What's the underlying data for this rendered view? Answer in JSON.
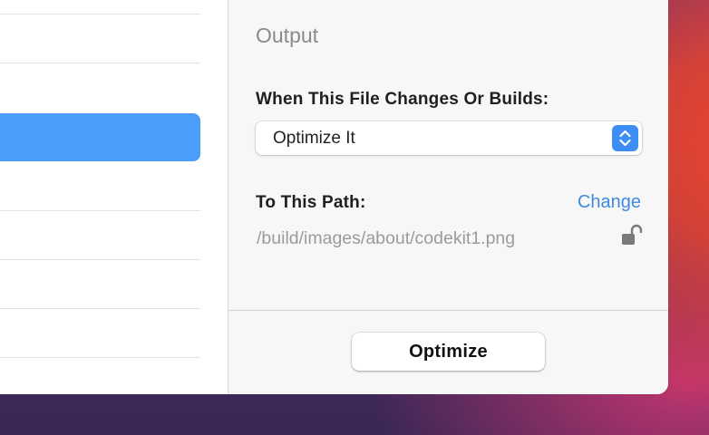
{
  "panel": {
    "section_title": "Output",
    "when_label": "When This File Changes Or Builds:",
    "select_value": "Optimize It",
    "path_label": "To This Path:",
    "change_link": "Change",
    "path_value": "/build/images/about/codekit1.png",
    "lock_icon": "unlock-icon",
    "optimize_button": "Optimize"
  },
  "colors": {
    "accent": "#4a9df8",
    "link": "#3d8be0"
  }
}
